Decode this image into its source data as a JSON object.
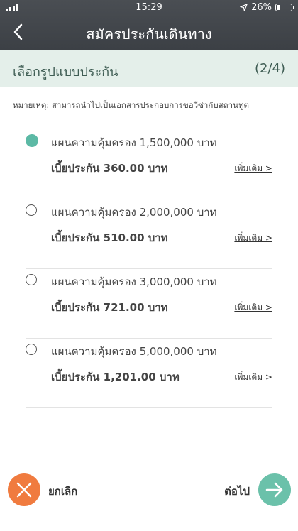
{
  "status_bar": {
    "time": "15:29",
    "battery": "26%"
  },
  "header": {
    "title": "สมัครประกันเดินทาง"
  },
  "step": {
    "label": "เลือกรูปแบบประกัน",
    "count": "(2/4)"
  },
  "note": "หมายเหตุ: สามารถนำไปเป็นเอกสารประกอบการขอวีซ่ากับสถานทูต",
  "plans": [
    {
      "label": "แผนความคุ้มครอง 1,500,000 บาท",
      "premium": "เบี้ยประกัน 360.00 บาท",
      "more": "เพิ่มเติม >",
      "selected": true
    },
    {
      "label": "แผนความคุ้มครอง 2,000,000 บาท",
      "premium": "เบี้ยประกัน 510.00 บาท",
      "more": "เพิ่มเติม >",
      "selected": false
    },
    {
      "label": "แผนความคุ้มครอง 3,000,000 บาท",
      "premium": "เบี้ยประกัน 721.00 บาท",
      "more": "เพิ่มเติม >",
      "selected": false
    },
    {
      "label": "แผนความคุ้มครอง 5,000,000 บาท",
      "premium": "เบี้ยประกัน 1,201.00 บาท",
      "more": "เพิ่มเติม >",
      "selected": false
    }
  ],
  "footer": {
    "cancel_label": "ยกเลิก",
    "next_label": "ต่อไป"
  },
  "colors": {
    "accent": "#5cb9a5",
    "cancel": "#f07b3f",
    "next": "#6bc1aa",
    "header": "#44484d",
    "stepbar": "#e4efea"
  },
  "icons": {
    "back": "chevron-left-icon",
    "cancel": "close-icon",
    "next": "arrow-right-icon",
    "location": "location-arrow-icon"
  }
}
